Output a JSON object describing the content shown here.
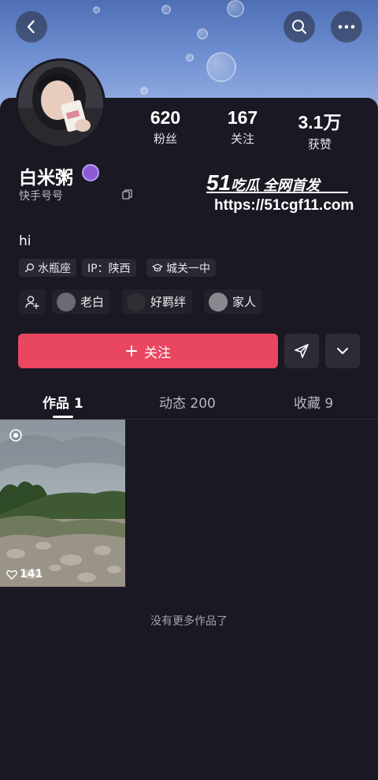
{
  "profile": {
    "name": "白米粥",
    "id_label": "快手号号",
    "bio": "hi"
  },
  "stats": [
    {
      "value": "620",
      "label": "粉丝"
    },
    {
      "value": "167",
      "label": "关注"
    },
    {
      "value": "3.1万",
      "label": "获赞"
    }
  ],
  "tags": [
    {
      "icon": "zodiac-icon",
      "label": "水瓶座"
    },
    {
      "icon": "",
      "label": "IP：陕西"
    },
    {
      "icon": "school-icon",
      "label": "城关一中"
    }
  ],
  "friends": [
    {
      "label": "老白"
    },
    {
      "label": "好羁绊"
    },
    {
      "label": "家人"
    }
  ],
  "actions": {
    "follow_label": "关注"
  },
  "tabs": [
    {
      "label": "作品 1"
    },
    {
      "label": "动态 200"
    },
    {
      "label": "收藏 9"
    }
  ],
  "posts": [
    {
      "likes": "141"
    }
  ],
  "footer_text": "没有更多作品了",
  "watermark": {
    "brand_num": "51",
    "brand_text": "吃瓜 全网首发",
    "url": "https://51cgf11.com"
  },
  "colors": {
    "accent": "#e9465f",
    "background": "#191823"
  }
}
